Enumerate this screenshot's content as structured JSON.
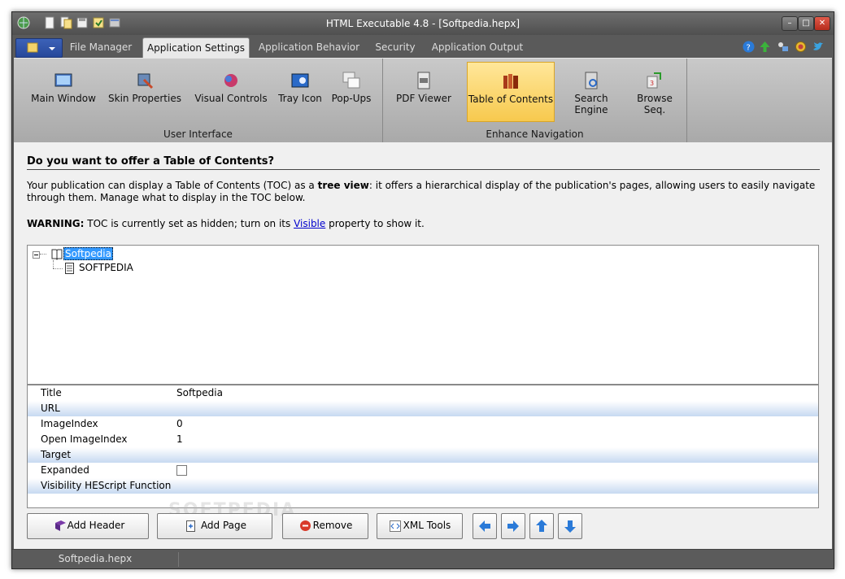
{
  "window": {
    "title": "HTML Executable 4.8 - [Softpedia.hepx]"
  },
  "menubar": {
    "tabs": [
      {
        "label": "File Manager"
      },
      {
        "label": "Application Settings"
      },
      {
        "label": "Application Behavior"
      },
      {
        "label": "Security"
      },
      {
        "label": "Application Output"
      }
    ]
  },
  "ribbon": {
    "groups": [
      {
        "label": "User Interface",
        "buttons": [
          {
            "label": "Main Window"
          },
          {
            "label": "Skin Properties"
          },
          {
            "label": "Visual Controls"
          },
          {
            "label": "Tray Icon"
          },
          {
            "label": "Pop-Ups"
          }
        ]
      },
      {
        "label": "Enhance Navigation",
        "buttons": [
          {
            "label": "PDF Viewer"
          },
          {
            "label": "Table of Contents"
          },
          {
            "label": "Search Engine"
          },
          {
            "label": "Browse Seq."
          }
        ]
      }
    ]
  },
  "content": {
    "heading": "Do you want to offer a Table of Contents?",
    "para_1": "Your publication can display a Table of Contents (TOC) as a ",
    "para_bold": "tree view",
    "para_2": ": it offers a hierarchical display of the publication's pages, allowing users to easily navigate through them. Manage what to display in the TOC below.",
    "warning_label": "WARNING:",
    "warning_text": " TOC is currently set as hidden; turn on its ",
    "warning_link": "Visible",
    "warning_tail": " property to show it."
  },
  "tree": {
    "root": "Softpedia",
    "child": "SOFTPEDIA"
  },
  "properties": {
    "rows": [
      {
        "name": "Title",
        "value": "Softpedia"
      },
      {
        "name": "URL",
        "value": ""
      },
      {
        "name": "ImageIndex",
        "value": "0"
      },
      {
        "name": "Open ImageIndex",
        "value": "1"
      },
      {
        "name": "Target",
        "value": ""
      },
      {
        "name": "Expanded",
        "value": ""
      },
      {
        "name": "Visibility HEScript Function",
        "value": ""
      }
    ]
  },
  "buttons": {
    "add_header": "Add Header",
    "add_page": "Add Page",
    "remove": "Remove",
    "xml_tools": "XML Tools"
  },
  "status": {
    "file": "Softpedia.hepx"
  },
  "watermark": "SOFTPEDIA"
}
